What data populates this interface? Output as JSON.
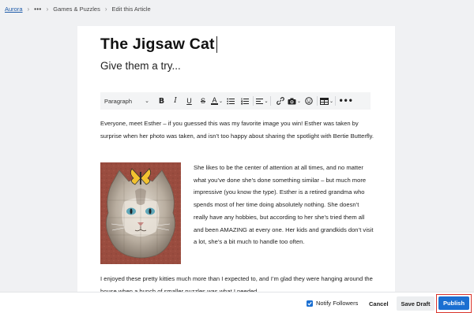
{
  "breadcrumb": {
    "home": "Aurora",
    "more": "•••",
    "board": "Games & Puzzles",
    "current": "Edit this Article"
  },
  "article": {
    "title": "The Jigsaw Cat",
    "subtitle": "Give them a try...",
    "paragraph1": "Everyone, meet Esther – if you guessed this was my favorite image you win! Esther was taken by surprise when her photo was taken, and isn’t too happy about sharing the spotlight with Bertie Butterfly.",
    "paragraph2": "She likes to be the center of attention at all times, and no matter what you’ve done she’s done something similar – but much more impressive (you know the type). Esther is a retired grandma who spends most of her time doing absolutely nothing. She doesn’t really have any hobbies, but according to her she’s tried them all and been AMAZING at every one. Her kids and grandkids don’t visit a lot, she’s a bit much to handle too often.",
    "paragraph3": "I enjoyed these pretty kitties much more than I expected to, and I’m glad they were hanging around the house when a bunch of smaller puzzles was what I needed."
  },
  "toolbar": {
    "block_format": "Paragraph",
    "bold": "B",
    "italic": "I",
    "underline": "U",
    "strike": "S",
    "font_color": "A",
    "more": "•••"
  },
  "footer": {
    "notify_label": "Notify Followers",
    "notify_checked": true,
    "cancel": "Cancel",
    "save_draft": "Save Draft",
    "publish": "Publish"
  },
  "colors": {
    "accent": "#1b6fd1",
    "highlight": "#d9342b",
    "link": "#1d5aa8"
  },
  "icons": [
    "bullet-list-icon",
    "numbered-list-icon",
    "align-icon",
    "link-icon",
    "camera-icon",
    "emoji-icon",
    "table-icon"
  ]
}
